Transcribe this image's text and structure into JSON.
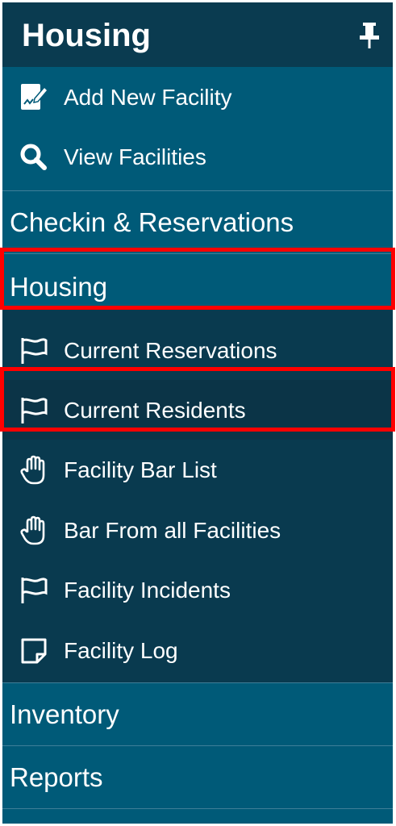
{
  "header": {
    "title": "Housing",
    "pin_icon": "pin-icon"
  },
  "facility_items": [
    {
      "label": "Add New Facility",
      "icon": "edit-document-icon"
    },
    {
      "label": "View Facilities",
      "icon": "search-icon"
    }
  ],
  "sections": {
    "checkin": "Checkin & Reservations",
    "housing": "Housing",
    "inventory": "Inventory",
    "reports": "Reports"
  },
  "housing_items": [
    {
      "label": "Current Reservations",
      "icon": "flag-icon"
    },
    {
      "label": "Current Residents",
      "icon": "flag-icon"
    },
    {
      "label": "Facility Bar List",
      "icon": "hand-stop-icon"
    },
    {
      "label": "Bar From all Facilities",
      "icon": "hand-stop-icon"
    },
    {
      "label": "Facility Incidents",
      "icon": "flag-icon"
    },
    {
      "label": "Facility Log",
      "icon": "sticky-note-icon"
    }
  ],
  "colors": {
    "panel": "#005a78",
    "header": "#0a3b50",
    "submenu": "#093a4f",
    "highlight_border": "#ff0000"
  }
}
